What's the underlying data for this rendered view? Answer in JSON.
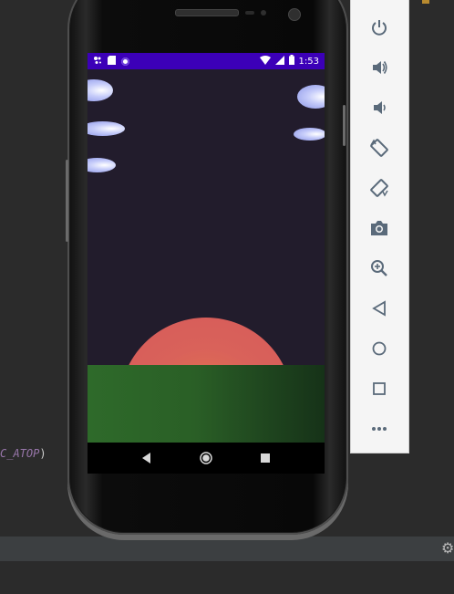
{
  "ide": {
    "code_fragment": "C_ATOP",
    "code_suffix": ")"
  },
  "device": {
    "status_bar": {
      "time": "1:53",
      "left_icons": [
        "assistant-icon",
        "sd-card-icon",
        "sync-icon"
      ],
      "right_icons": [
        "wifi-icon",
        "signal-icon",
        "battery-icon"
      ],
      "color": "#3c00b8"
    },
    "scene": {
      "sky_color": "#221c2c",
      "sun_color": "#d65a5a",
      "grass_color": "#2a5f26",
      "cloud_color": "#aeb6f5"
    },
    "nav_bar": {
      "buttons": [
        "back-icon",
        "home-icon",
        "recents-icon"
      ]
    }
  },
  "emulator_toolbar": {
    "buttons": [
      "power-icon",
      "volume-up-icon",
      "volume-down-icon",
      "rotate-left-icon",
      "rotate-right-icon",
      "camera-icon",
      "zoom-icon",
      "back-icon",
      "home-icon",
      "overview-icon",
      "more-icon"
    ]
  },
  "colors": {
    "ide_background": "#2b2b2b",
    "toolbar_icon": "#5a6a7a",
    "code_constant": "#9876aa"
  }
}
